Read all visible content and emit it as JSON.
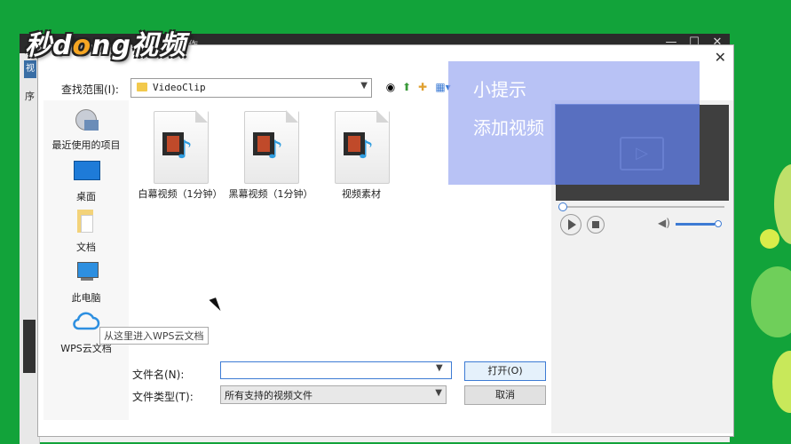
{
  "background_window": {
    "title": "作",
    "left_strip_tab": "视",
    "left_strip_label": "序",
    "window_controls": [
      "—",
      "☐",
      "✕"
    ]
  },
  "dialog": {
    "close_glyph": "✕",
    "lookin_label": "查找范围(I):",
    "path_value": "VideoClip",
    "places": [
      {
        "label": "最近使用的项目",
        "icon": "recent-items-icon"
      },
      {
        "label": "桌面",
        "icon": "desktop-icon"
      },
      {
        "label": "文档",
        "icon": "documents-icon"
      },
      {
        "label": "此电脑",
        "icon": "this-pc-icon"
      },
      {
        "label": "WPS云文档",
        "icon": "wps-cloud-icon"
      }
    ],
    "files": [
      {
        "label": "白幕视频（1分钟）",
        "icon": "video-file-icon"
      },
      {
        "label": "黑幕视频（1分钟）",
        "icon": "video-file-icon"
      },
      {
        "label": "视频素材",
        "icon": "video-file-icon"
      }
    ],
    "tooltip": "从这里进入WPS云文档",
    "filename_label": "文件名(N):",
    "filename_value": "",
    "filetype_label": "文件类型(T):",
    "filetype_value": "所有支持的视频文件",
    "open_button": "打开(O)",
    "cancel_button": "取消"
  },
  "preview": {
    "seek_position": 0,
    "volume_level": 1
  },
  "tip_overlay": {
    "title": "小提示",
    "body": "添加视频"
  },
  "watermark": {
    "text_a": "秒d",
    "text_o": "o",
    "text_b": "ng视频"
  },
  "colors": {
    "background_green": "#12a33a",
    "accent_blue": "#3d7bd4",
    "tip_overlay": "#96a5f0"
  }
}
